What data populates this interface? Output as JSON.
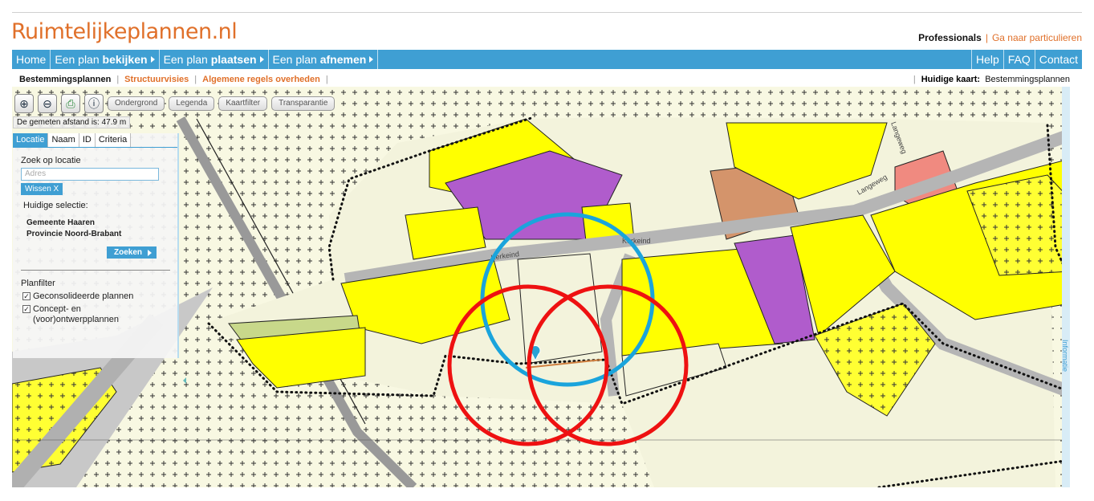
{
  "header": {
    "logo": "Ruimtelijkeplannen.nl",
    "professionals": "Professionals",
    "separator": "|",
    "particulieren_link": "Ga naar particulieren"
  },
  "nav": {
    "home": "Home",
    "items": [
      {
        "pre": "Een plan ",
        "bold": "bekijken"
      },
      {
        "pre": "Een plan ",
        "bold": "plaatsen"
      },
      {
        "pre": "Een plan ",
        "bold": "afnemen"
      }
    ],
    "right": [
      "Help",
      "FAQ",
      "Contact"
    ]
  },
  "subnav": {
    "items": [
      "Bestemmingsplannen",
      "Structuurvisies",
      "Algemene regels overheden"
    ],
    "current_map_label": "Huidige kaart:",
    "current_map_value": "Bestemmingsplannen"
  },
  "toolbar": {
    "icons": [
      "zoom-in-icon",
      "zoom-out-icon",
      "print-icon",
      "info-icon"
    ],
    "buttons": [
      "Ondergrond",
      "Legenda",
      "Kaartfilter",
      "Transparantie"
    ]
  },
  "measure": "De gemeten afstand is: 47.9 m",
  "panel": {
    "tabs": [
      "Locatie",
      "Naam",
      "ID",
      "Criteria"
    ],
    "search_label": "Zoek op locatie",
    "address_placeholder": "Adres",
    "clear_button": "Wissen  X",
    "selection_label": "Huidige selectie:",
    "selection": [
      "Gemeente Haaren",
      "Provincie Noord-Brabant"
    ],
    "search_button": "Zoeken",
    "filter_label": "Planfilter",
    "filters": [
      "Geconsolideerde plannen",
      "Concept- en",
      "(voor)ontwerpplannen"
    ]
  },
  "map": {
    "streets": [
      "Kerkeind",
      "Kerkeind",
      "Langeweg",
      "Langeweg"
    ]
  },
  "info_tab": "Informatie",
  "colors": {
    "accent": "#3f9fd3",
    "brand": "#e0702a",
    "yellow": "#ffff00",
    "purple": "#b05ccc",
    "red_circle": "#ee1111",
    "blue_circle": "#1aa4dc"
  }
}
